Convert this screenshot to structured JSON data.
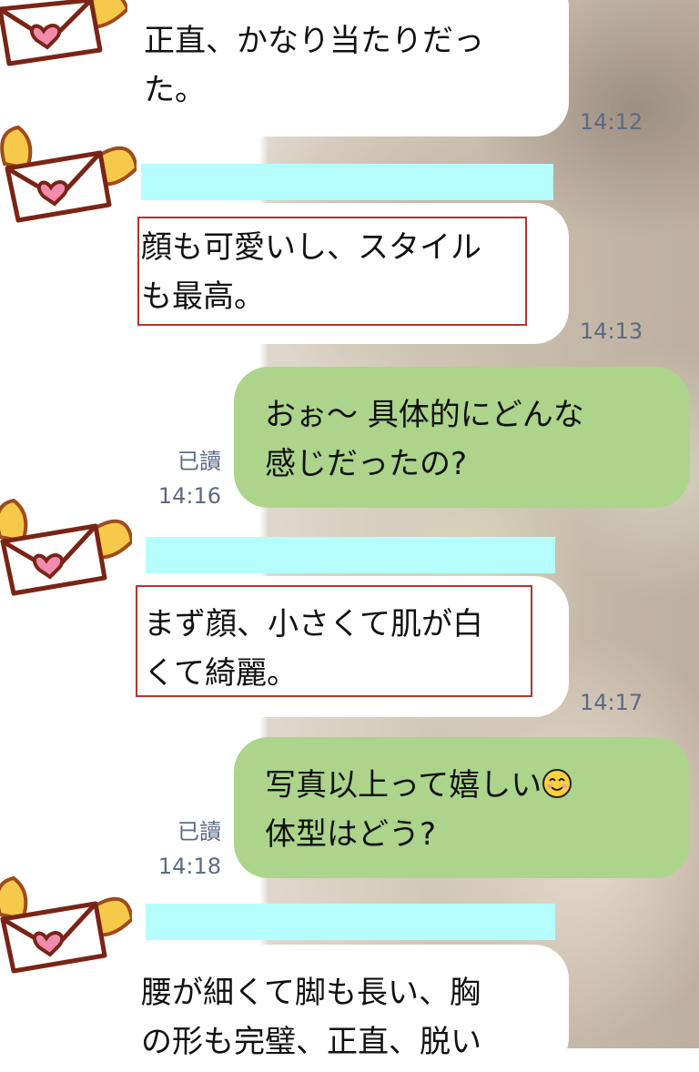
{
  "messages": [
    {
      "side": "in",
      "text": "正直、かなり当たりだった。",
      "line1": "正直、かなり当たりだっ",
      "line2": "た。",
      "time": "14:12"
    },
    {
      "side": "in",
      "line1": "顔も可愛いし、スタイル",
      "line2": "も最高。",
      "time": "14:13"
    },
    {
      "side": "out",
      "line1": "おぉ～ 具体的にどんな",
      "line2": "感じだったの?",
      "read": "已讀",
      "time": "14:16"
    },
    {
      "side": "in",
      "line1": "まず顔、小さくて肌が白",
      "line2": "くて綺麗。",
      "time": "14:17"
    },
    {
      "side": "out",
      "line1": "写真以上って嬉しい",
      "line2": "体型はどう?",
      "read": "已讀",
      "time": "14:18",
      "emoji": "smiling-face-emoji"
    },
    {
      "side": "in",
      "line1": "腰が細くて脚も長い、胸",
      "line2": "の形も完璧、正直、脱い",
      "time": ""
    }
  ],
  "colors": {
    "incoming_bubble": "#ffffff",
    "outgoing_bubble": "#acd48a",
    "name_bar": "#b6fdfd",
    "highlight_border": "#b0362e",
    "timestamp": "#5b6a86"
  },
  "icons": {
    "avatar": "winged-love-letter-icon"
  }
}
